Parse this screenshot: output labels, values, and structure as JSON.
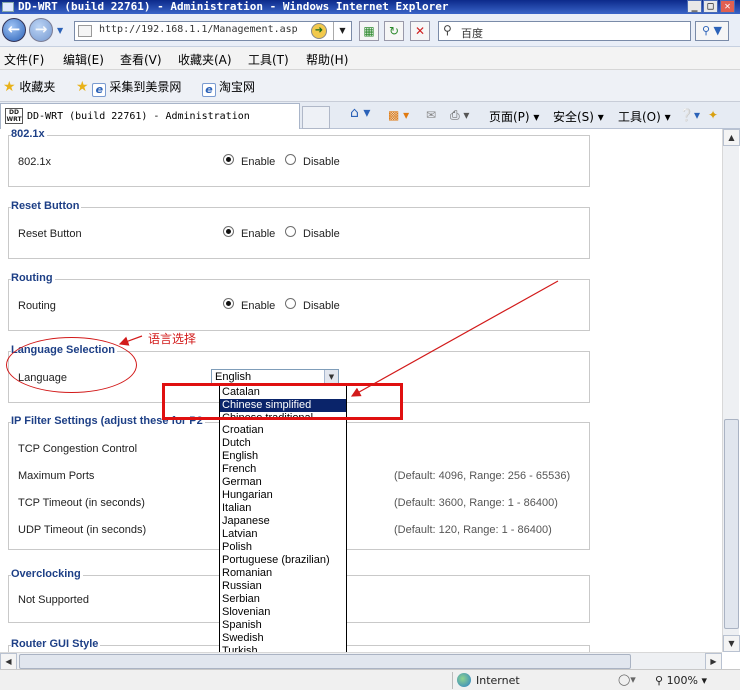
{
  "window": {
    "title": "DD-WRT (build 22761) - Administration - Windows Internet Explorer",
    "buttons": {
      "minimize": "_",
      "maximize": "□",
      "close": "✕"
    }
  },
  "address_bar": {
    "url": "http://192.168.1.1/Management.asp",
    "search_placeholder": "百度"
  },
  "menu": [
    "文件(F)",
    "编辑(E)",
    "查看(V)",
    "收藏夹(A)",
    "工具(T)",
    "帮助(H)"
  ],
  "favorites": {
    "label": "收藏夹",
    "items": [
      "采集到美景网",
      "淘宝网"
    ]
  },
  "tab": {
    "title": "DD-WRT (build 22761) - Administration"
  },
  "commands": {
    "page": "页面(P)",
    "safety": "安全(S)",
    "tools": "工具(O)"
  },
  "sections": {
    "s8021x": {
      "legend": "802.1x",
      "label": "802.1x",
      "enable": "Enable",
      "disable": "Disable",
      "value": "enable"
    },
    "reset": {
      "legend": "Reset Button",
      "label": "Reset Button",
      "enable": "Enable",
      "disable": "Disable",
      "value": "enable"
    },
    "routing": {
      "legend": "Routing",
      "label": "Routing",
      "enable": "Enable",
      "disable": "Disable",
      "value": "enable"
    },
    "language": {
      "legend": "Language Selection",
      "label": "Language",
      "selected": "English"
    },
    "ipfilter": {
      "legend": "IP Filter Settings (adjust these for P2",
      "rows": [
        {
          "label": "TCP Congestion Control",
          "hint": ""
        },
        {
          "label": "Maximum Ports",
          "hint": "(Default: 4096, Range: 256 - 65536)"
        },
        {
          "label": "TCP Timeout (in seconds)",
          "hint": "(Default: 3600, Range: 1 - 86400)"
        },
        {
          "label": "UDP Timeout (in seconds)",
          "hint": "(Default: 120, Range: 1 - 86400)"
        }
      ]
    },
    "overclocking": {
      "legend": "Overclocking",
      "label": "Not Supported"
    },
    "gui_style": {
      "legend": "Router GUI Style"
    }
  },
  "language_options_top": [
    "Catalan",
    "Chinese simplified",
    "Chinese traditional"
  ],
  "language_options": [
    "Croatian",
    "Dutch",
    "English",
    "French",
    "German",
    "Hungarian",
    "Italian",
    "Japanese",
    "Latvian",
    "Polish",
    "Portuguese (brazilian)",
    "Romanian",
    "Russian",
    "Serbian",
    "Slovenian",
    "Spanish",
    "Swedish",
    "Turkish"
  ],
  "highlighted_option": "Chinese simplified",
  "annotation": {
    "text": "语言选择",
    "color": "#d21a1a"
  },
  "status": {
    "zone": "Internet",
    "zoom": "100%"
  }
}
